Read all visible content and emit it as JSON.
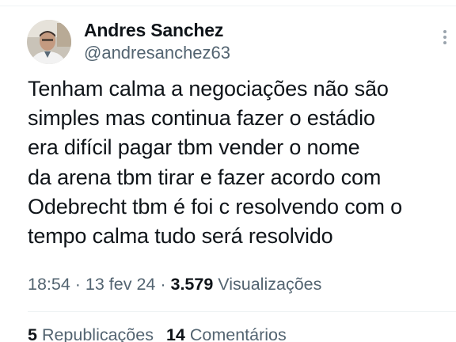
{
  "author": {
    "name": "Andres Sanchez",
    "handle": "@andresanchez63",
    "avatar_icon": "profile-photo"
  },
  "tweet": {
    "lines": [
      "Tenham calma a negociações não são",
      "simples mas continua fazer o estádio",
      "era difícil pagar tbm vender o nome",
      "da arena tbm tirar e fazer acordo com",
      "Odebrecht tbm é foi c resolvendo com o",
      "tempo calma tudo será resolvido"
    ]
  },
  "meta": {
    "time": "18:54",
    "sep1": " · ",
    "date": "13 fev 24",
    "sep2": " · ",
    "views_count": "3.579",
    "views_label": " Visualizações"
  },
  "stats": {
    "reposts_count": "5",
    "reposts_label": " Republicações",
    "comments_count": "14",
    "comments_label": " Comentários"
  },
  "colors": {
    "text": "#0f1419",
    "secondary": "#536471",
    "divider": "#eff3f4"
  }
}
